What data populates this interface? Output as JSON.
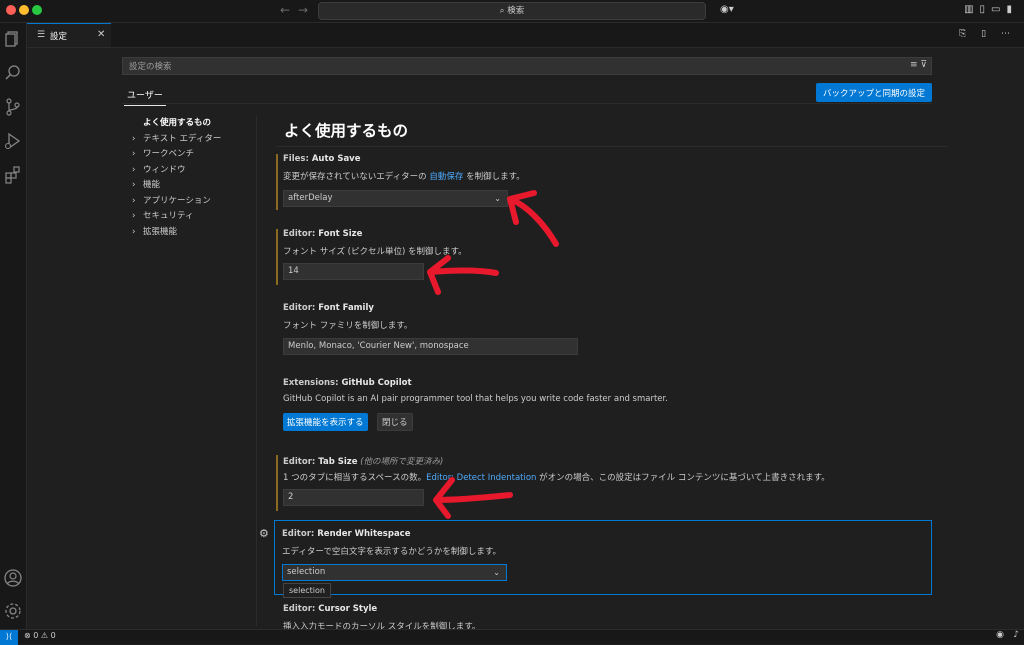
{
  "titlebar": {
    "search": "検索"
  },
  "tab": {
    "label": "設定"
  },
  "search": {
    "placeholder": "設定の検索"
  },
  "scope": {
    "user_tab": "ユーザー",
    "sync_button": "バックアップと同期の設定"
  },
  "toc": {
    "active": "よく使用するもの",
    "items": [
      "テキスト エディター",
      "ワークベンチ",
      "ウィンドウ",
      "機能",
      "アプリケーション",
      "セキュリティ",
      "拡張機能"
    ]
  },
  "section_title": "よく使用するもの",
  "settings": {
    "auto_save": {
      "category": "Files: ",
      "name": "Auto Save",
      "desc_before": "変更が保存されていないエディターの ",
      "desc_link": "自動保存",
      "desc_after": " を制御します。",
      "value": "afterDelay"
    },
    "font_size": {
      "category": "Editor: ",
      "name": "Font Size",
      "desc": "フォント サイズ (ピクセル単位) を制御します。",
      "value": "14"
    },
    "font_family": {
      "category": "Editor: ",
      "name": "Font Family",
      "desc": "フォント ファミリを制御します。",
      "value": "Menlo, Monaco, 'Courier New', monospace"
    },
    "copilot": {
      "category": "Extensions: ",
      "name": "GitHub Copilot",
      "desc": "GitHub Copilot is an AI pair programmer tool that helps you write code faster and smarter.",
      "show_button": "拡張機能を表示する",
      "close_button": "閉じる"
    },
    "tab_size": {
      "category": "Editor: ",
      "name": "Tab Size",
      "note": "(他の場所で変更済み)",
      "desc_before": "1 つのタブに相当するスペースの数。",
      "desc_link": "Editor: Detect Indentation",
      "desc_after": " がオンの場合、この設定はファイル コンテンツに基づいて上書きされます。",
      "value": "2"
    },
    "render_whitespace": {
      "category": "Editor: ",
      "name": "Render Whitespace",
      "desc": "エディターで空白文字を表示するかどうかを制御します。",
      "value": "selection",
      "tooltip": "selection"
    },
    "cursor_style": {
      "category": "Editor: ",
      "name": "Cursor Style",
      "desc": "挿入入力モードのカーソル スタイルを制御します。"
    }
  },
  "statusbar": {
    "errors": "0",
    "warnings": "0"
  },
  "icons": {
    "activity": [
      "explorer-icon",
      "search-icon",
      "source-control-icon",
      "run-debug-icon",
      "extensions-icon",
      "account-icon",
      "manage-gear-icon"
    ]
  },
  "colors": {
    "accent": "#0078d4",
    "annotation": "#e8192c",
    "modified": "#8b6a1f",
    "link": "#4daafc"
  }
}
